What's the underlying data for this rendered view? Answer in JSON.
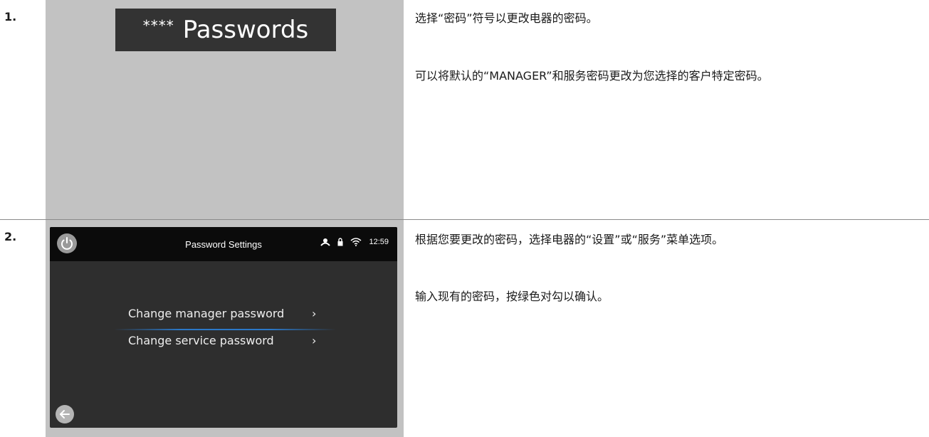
{
  "steps": [
    {
      "number": "1.",
      "badge": {
        "stars": "****",
        "label": "Passwords"
      },
      "instructions": [
        "选择“密码”符号以更改电器的密码。",
        "可以将默认的“MANAGER”和服务密码更改为您选择的客户特定密码。"
      ]
    },
    {
      "number": "2.",
      "screen": {
        "title": "Password Settings",
        "time": "12:59",
        "icons": [
          "power-icon",
          "person-icon",
          "lock-icon",
          "wifi-icon",
          "back-arrow-icon"
        ],
        "menu": [
          {
            "label": "Change manager password",
            "chevron": "›"
          },
          {
            "label": "Change service password",
            "chevron": "›"
          }
        ]
      },
      "instructions": [
        "根据您要更改的密码，选择电器的“设置”或“服务”菜单选项。",
        "输入现有的密码，按绿色对勾以确认。"
      ]
    }
  ],
  "colors": {
    "panel_gray": "#c2c2c2",
    "screen_bg": "#2e2e2e",
    "topbar_bg": "#0b0b0b",
    "accent_blue": "#2b78c8"
  }
}
